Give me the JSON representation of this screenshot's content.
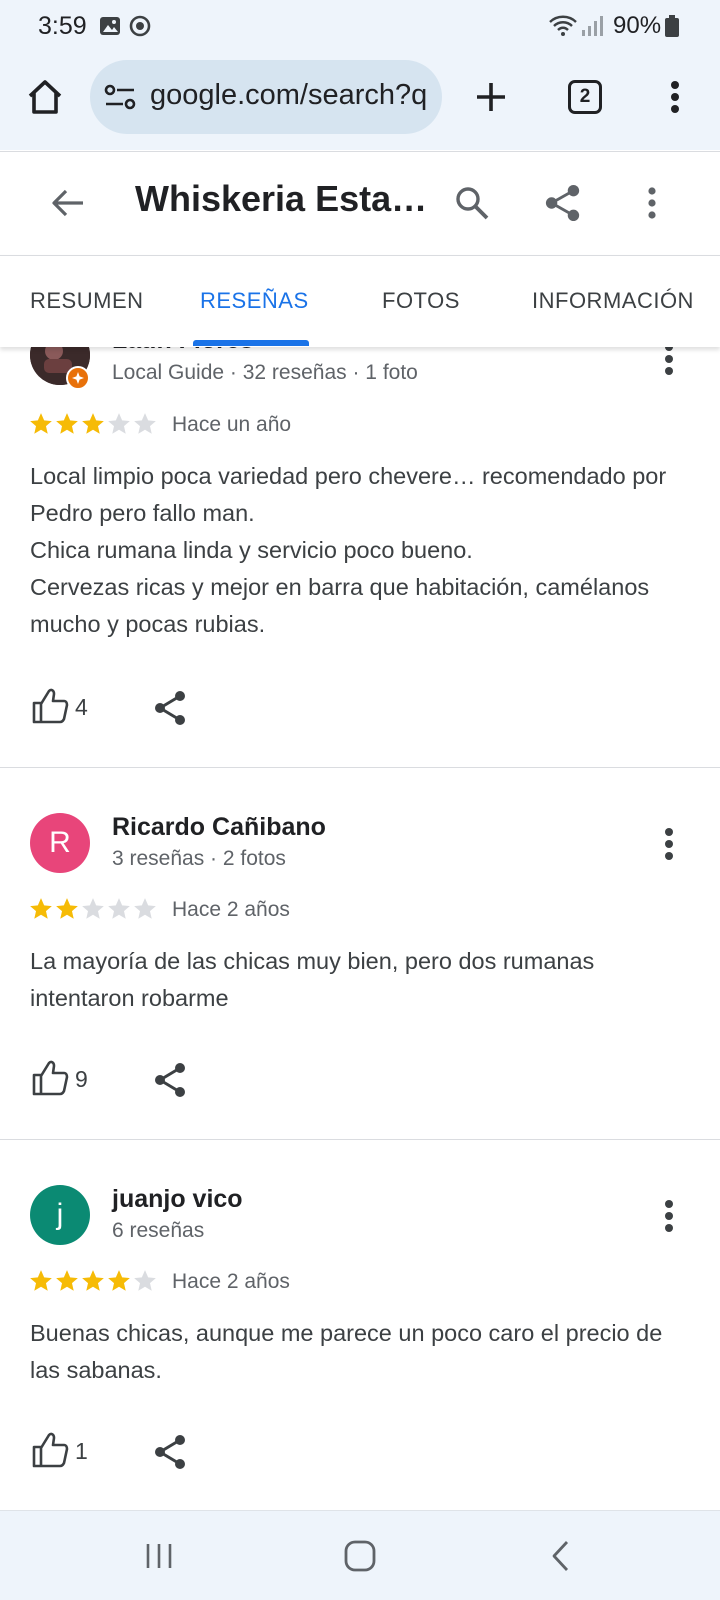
{
  "status_bar": {
    "time": "3:59",
    "battery": "90%",
    "icons": [
      "gallery-icon",
      "sync-icon",
      "wifi-icon",
      "signal-icon",
      "battery-icon"
    ]
  },
  "browser": {
    "url": "google.com/search?q",
    "tab_count": "2",
    "icons": [
      "home-icon",
      "site-settings-icon",
      "new-tab-icon",
      "tab-switcher-icon",
      "menu-icon"
    ]
  },
  "header": {
    "title": "Whiskeria Esta…",
    "icons": [
      "back-arrow-icon",
      "search-icon",
      "share-icon",
      "more-vert-icon"
    ]
  },
  "tabs": [
    {
      "label": "RESUMEN",
      "active": false
    },
    {
      "label": "RESEÑAS",
      "active": true
    },
    {
      "label": "FOTOS",
      "active": false
    },
    {
      "label": "INFORMACIÓN",
      "active": false
    }
  ],
  "reviews": [
    {
      "name": "Latin Flores",
      "meta": "Local Guide · 32 reseñas · 1 foto",
      "avatar_letter": "",
      "avatar_color": "#3b2a2a",
      "rating": 3,
      "time": "Hace un año",
      "text": "Local limpio poca variedad pero chevere… recomendado por Pedro pero fallo man.\nChica rumana linda y servicio poco bueno.\nCervezas ricas y mejor en barra que habitación, camélanos mucho y pocas rubias.",
      "likes": "4"
    },
    {
      "name": "Ricardo Cañibano",
      "meta": "3 reseñas · 2 fotos",
      "avatar_letter": "R",
      "avatar_color": "#e8457a",
      "rating": 2,
      "time": "Hace 2 años",
      "text": "La mayoría de las chicas muy bien, pero dos rumanas intentaron robarme",
      "likes": "9"
    },
    {
      "name": "juanjo vico",
      "meta": "6 reseñas",
      "avatar_letter": "j",
      "avatar_color": "#0b8a73",
      "rating": 4,
      "time": "Hace 2 años",
      "text": "Buenas chicas, aunque me parece un poco caro el precio de las sabanas.",
      "likes": "1"
    }
  ],
  "colors": {
    "accent": "#1a73e8",
    "star_filled": "#f6bb06",
    "star_empty": "#dadce0",
    "chrome_bg": "#eef4fb"
  },
  "navbar": {
    "icons": [
      "recent-apps-icon",
      "home-button-icon",
      "back-nav-icon"
    ]
  }
}
